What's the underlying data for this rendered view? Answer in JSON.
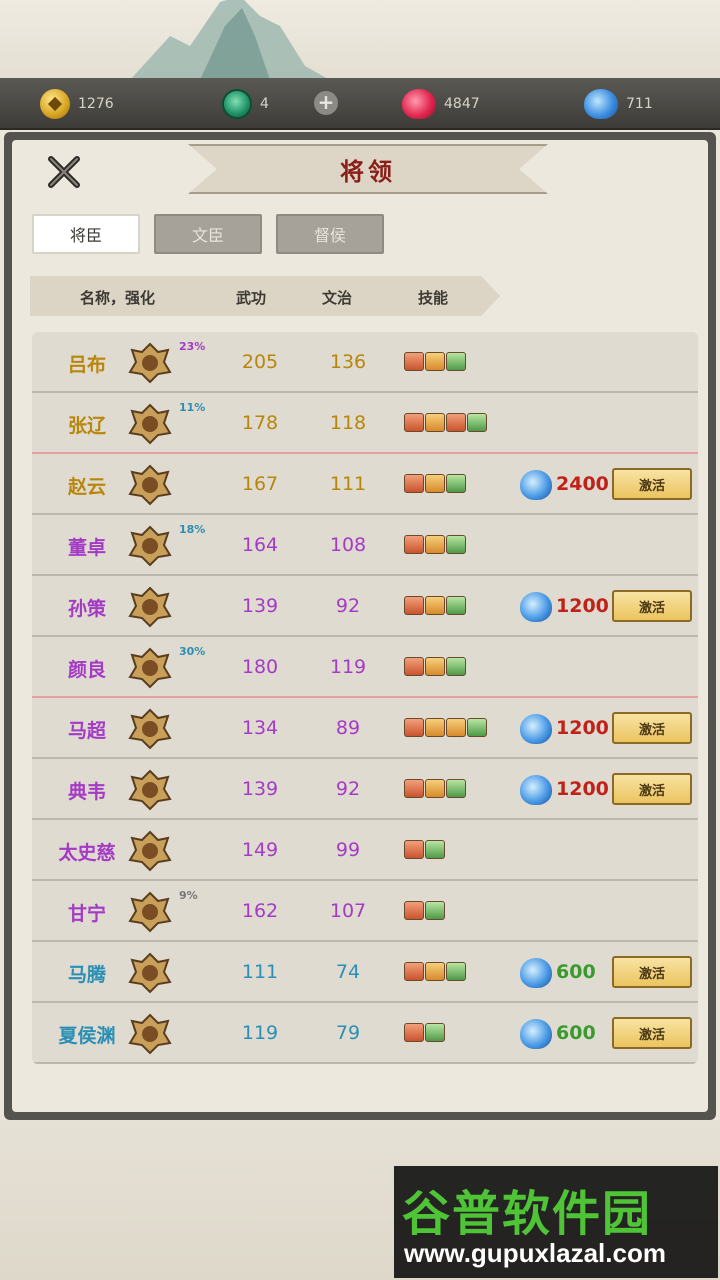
{
  "resources": {
    "coins": "1276",
    "jade": "4",
    "red_gems": "4847",
    "blue_gems": "711"
  },
  "title": "将领",
  "tabs": [
    "将臣",
    "文臣",
    "督侯"
  ],
  "active_tab": 0,
  "columns": {
    "name": "名称，强化",
    "martial": "武功",
    "civil": "文治",
    "skills": "技能"
  },
  "activate_label": "激活",
  "colors": {
    "gold": "#b8860b",
    "purple": "#a43bc4",
    "blue": "#2b8fb5",
    "cost_red": "#c0221a",
    "cost_green": "#3a9a2e"
  },
  "generals": [
    {
      "name": "吕布",
      "pct": "23%",
      "wu": "205",
      "wen": "136",
      "skills": [
        "red",
        "orange",
        "green"
      ],
      "tier": "gold",
      "cost": "",
      "cost_color": "",
      "locked": false,
      "red_line": false
    },
    {
      "name": "张辽",
      "pct": "11%",
      "wu": "178",
      "wen": "118",
      "skills": [
        "red",
        "orange",
        "red",
        "green"
      ],
      "tier": "gold",
      "cost": "",
      "cost_color": "",
      "locked": false,
      "red_line": true
    },
    {
      "name": "赵云",
      "pct": "",
      "wu": "167",
      "wen": "111",
      "skills": [
        "red",
        "orange",
        "green"
      ],
      "tier": "gold",
      "cost": "2400",
      "cost_color": "cost_red",
      "locked": true,
      "red_line": false
    },
    {
      "name": "董卓",
      "pct": "18%",
      "wu": "164",
      "wen": "108",
      "skills": [
        "red",
        "orange",
        "green"
      ],
      "tier": "purple",
      "cost": "",
      "cost_color": "",
      "locked": false,
      "red_line": false
    },
    {
      "name": "孙策",
      "pct": "",
      "wu": "139",
      "wen": "92",
      "skills": [
        "red",
        "orange",
        "green"
      ],
      "tier": "purple",
      "cost": "1200",
      "cost_color": "cost_red",
      "locked": true,
      "red_line": false
    },
    {
      "name": "颜良",
      "pct": "30%",
      "wu": "180",
      "wen": "119",
      "skills": [
        "red",
        "orange",
        "green"
      ],
      "tier": "purple",
      "cost": "",
      "cost_color": "",
      "locked": false,
      "red_line": true
    },
    {
      "name": "马超",
      "pct": "",
      "wu": "134",
      "wen": "89",
      "skills": [
        "red",
        "orange",
        "orange",
        "green"
      ],
      "tier": "purple",
      "cost": "1200",
      "cost_color": "cost_red",
      "locked": true,
      "red_line": false
    },
    {
      "name": "典韦",
      "pct": "",
      "wu": "139",
      "wen": "92",
      "skills": [
        "red",
        "orange",
        "green"
      ],
      "tier": "purple",
      "cost": "1200",
      "cost_color": "cost_red",
      "locked": true,
      "red_line": false
    },
    {
      "name": "太史慈",
      "pct": "",
      "wu": "149",
      "wen": "99",
      "skills": [
        "red",
        "green"
      ],
      "tier": "purple",
      "cost": "",
      "cost_color": "",
      "locked": false,
      "red_line": false
    },
    {
      "name": "甘宁",
      "pct": "9%",
      "wu": "162",
      "wen": "107",
      "skills": [
        "red",
        "green"
      ],
      "tier": "purple",
      "cost": "",
      "cost_color": "",
      "locked": false,
      "red_line": false
    },
    {
      "name": "马腾",
      "pct": "",
      "wu": "111",
      "wen": "74",
      "skills": [
        "red",
        "orange",
        "green"
      ],
      "tier": "blue",
      "cost": "600",
      "cost_color": "cost_green",
      "locked": true,
      "red_line": false
    },
    {
      "name": "夏侯渊",
      "pct": "",
      "wu": "119",
      "wen": "79",
      "skills": [
        "red",
        "green"
      ],
      "tier": "blue",
      "cost": "600",
      "cost_color": "cost_green",
      "locked": true,
      "red_line": false
    }
  ],
  "watermark": {
    "main": "谷普软件园",
    "url": "www.gupuxlazal.com"
  }
}
